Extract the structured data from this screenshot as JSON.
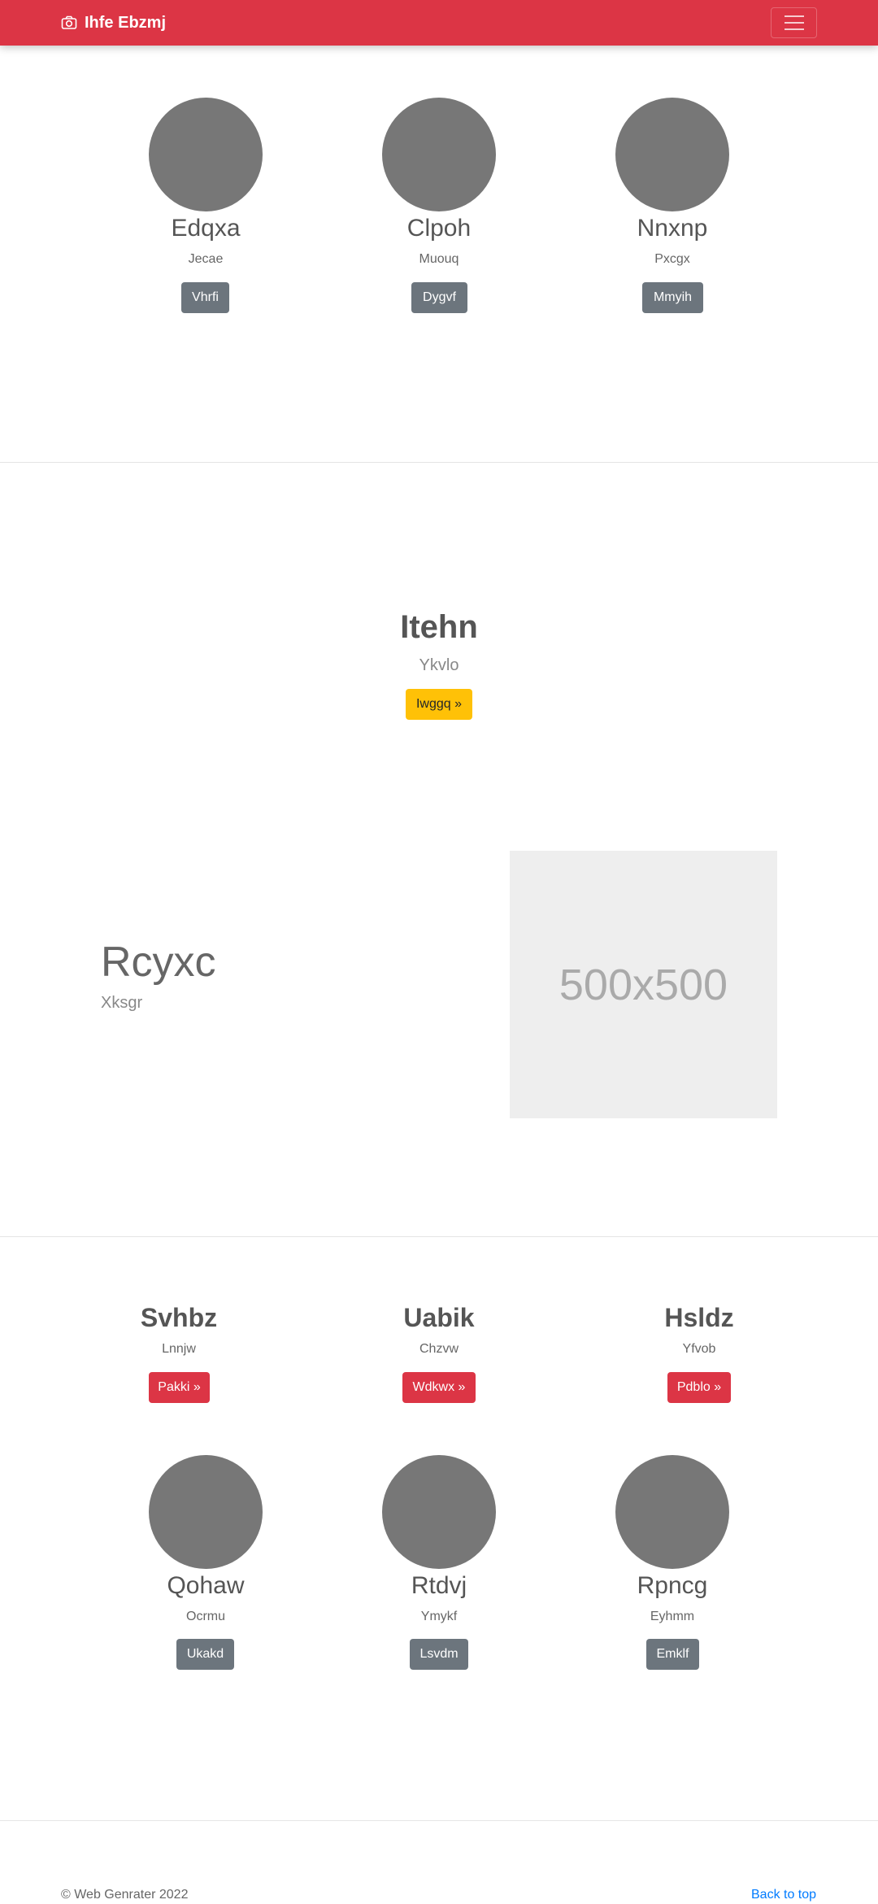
{
  "navbar": {
    "brand": "Ihfe Ebzmj",
    "brand_icon": "camera-icon",
    "toggler_icon": "hamburger-menu-icon",
    "color": "#dc3545"
  },
  "team_top": [
    {
      "name": "Edqxa",
      "role": "Jecae",
      "button": "Vhrfi"
    },
    {
      "name": "Clpoh",
      "role": "Muouq",
      "button": "Dygvf"
    },
    {
      "name": "Nnxnp",
      "role": "Pxcgx",
      "button": "Mmyih"
    }
  ],
  "hero": {
    "title": "Itehn",
    "subtitle": "Ykvlo",
    "button": "Iwggq »"
  },
  "feature": {
    "title": "Rcyxc",
    "subtitle": "Xksgr",
    "image_text": "500x500"
  },
  "columns": [
    {
      "title": "Svhbz",
      "text": "Lnnjw",
      "button": "Pakki »"
    },
    {
      "title": "Uabik",
      "text": "Chzvw",
      "button": "Wdkwx »"
    },
    {
      "title": "Hsldz",
      "text": "Yfvob",
      "button": "Pdblo »"
    }
  ],
  "team_bottom": [
    {
      "name": "Qohaw",
      "role": "Ocrmu",
      "button": "Ukakd"
    },
    {
      "name": "Rtdvj",
      "role": "Ymykf",
      "button": "Lsvdm"
    },
    {
      "name": "Rpncg",
      "role": "Eyhmm",
      "button": "Emklf"
    }
  ],
  "footer": {
    "copyright": "© Web Genrater 2022",
    "back_to_top": "Back to top"
  }
}
